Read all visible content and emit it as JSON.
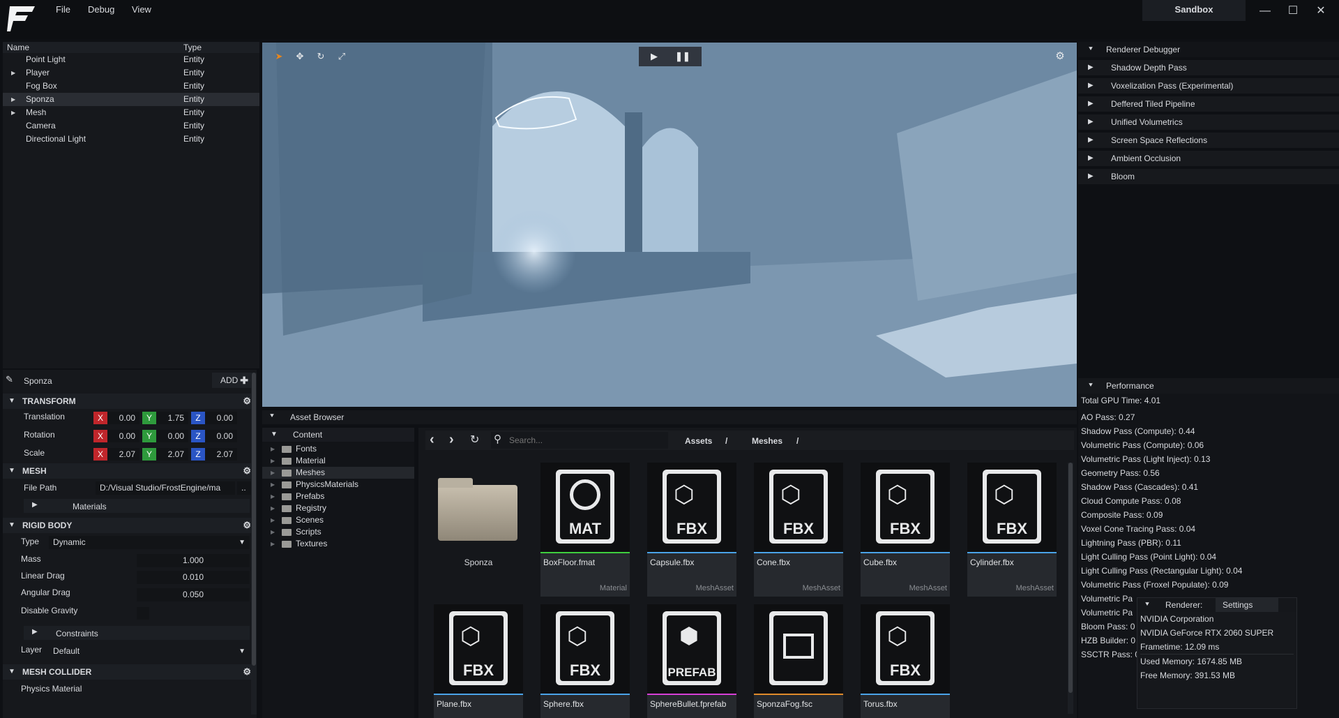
{
  "menu": {
    "file": "File",
    "debug": "Debug",
    "view": "View"
  },
  "window": {
    "title": "Sandbox",
    "minimize": "—",
    "maximize": "☐",
    "close": "✕"
  },
  "hierarchy": {
    "col_name": "Name",
    "col_type": "Type",
    "rows": [
      {
        "name": "Point Light",
        "type": "Entity"
      },
      {
        "name": "Player",
        "type": "Entity"
      },
      {
        "name": "Fog Box",
        "type": "Entity"
      },
      {
        "name": "Sponza",
        "type": "Entity"
      },
      {
        "name": "Mesh",
        "type": "Entity"
      },
      {
        "name": "Camera",
        "type": "Entity"
      },
      {
        "name": "Directional Light",
        "type": "Entity"
      }
    ]
  },
  "inspector": {
    "entity_name": "Sponza",
    "add_label": "ADD",
    "transform": {
      "title": "TRANSFORM",
      "translation": {
        "label": "Translation",
        "x": "0.00",
        "y": "1.75",
        "z": "0.00"
      },
      "rotation": {
        "label": "Rotation",
        "x": "0.00",
        "y": "0.00",
        "z": "0.00"
      },
      "scale": {
        "label": "Scale",
        "x": "2.07",
        "y": "2.07",
        "z": "2.07"
      }
    },
    "axis": {
      "x": "X",
      "y": "Y",
      "z": "Z"
    },
    "mesh": {
      "title": "MESH",
      "file_path_label": "File Path",
      "file_path": "D:/Visual Studio/FrostEngine/ma",
      "browse": "..",
      "materials": "Materials"
    },
    "rigid_body": {
      "title": "RIGID BODY",
      "type_label": "Type",
      "type_value": "Dynamic",
      "mass_label": "Mass",
      "mass": "1.000",
      "linear_drag_label": "Linear Drag",
      "linear_drag": "0.010",
      "angular_drag_label": "Angular Drag",
      "angular_drag": "0.050",
      "disable_gravity_label": "Disable Gravity",
      "constraints": "Constraints",
      "layer_label": "Layer",
      "layer_value": "Default"
    },
    "mesh_collider": {
      "title": "MESH COLLIDER",
      "physics_material_label": "Physics Material"
    }
  },
  "renderer_debugger": {
    "title": "Renderer Debugger",
    "items": [
      "Shadow Depth Pass",
      "Voxelization Pass (Experimental)",
      "Deffered Tiled Pipeline",
      "Unified Volumetrics",
      "Screen Space Reflections",
      "Ambient Occlusion",
      "Bloom"
    ]
  },
  "performance": {
    "title": "Performance",
    "total": "Total GPU Time: 4.01",
    "lines": [
      "AO Pass: 0.27",
      "Shadow Pass (Compute): 0.44",
      "Volumetric Pass (Compute): 0.06",
      "Volumetric Pass (Light Inject): 0.13",
      "Geometry Pass: 0.56",
      "Shadow Pass (Cascades): 0.41",
      "Cloud Compute Pass: 0.08",
      "Composite Pass: 0.09",
      "Voxel Cone Tracing Pass: 0.04",
      "Lightning Pass (PBR): 0.11",
      "Light Culling Pass (Point Light): 0.04",
      "Light Culling Pass (Rectangular Light): 0.04",
      "Volumetric Pass (Froxel Populate): 0.09",
      "Volumetric Pa",
      "Volumetric Pa",
      "Bloom Pass: 0",
      "HZB Builder: 0",
      "SSCTR Pass: 0"
    ]
  },
  "renderer_panel": {
    "tab_renderer": "Renderer:",
    "tab_settings": "Settings",
    "vendor": "NVIDIA Corporation",
    "gpu": "NVIDIA GeForce RTX 2060 SUPER",
    "frametime": "Frametime: 12.09 ms",
    "used_memory": "Used Memory: 1674.85 MB",
    "free_memory": "Free Memory: 391.53 MB"
  },
  "asset_browser": {
    "title": "Asset Browser",
    "root": "Content",
    "folders": [
      "Fonts",
      "Material",
      "Meshes",
      "PhysicsMaterials",
      "Prefabs",
      "Registry",
      "Scenes",
      "Scripts",
      "Textures"
    ],
    "search_placeholder": "Search...",
    "breadcrumb": [
      "Assets",
      "/",
      "Meshes",
      "/"
    ],
    "items": [
      {
        "name": "Sponza",
        "type": "",
        "ext": "",
        "kind": "folder",
        "color": ""
      },
      {
        "name": "BoxFloor.fmat",
        "type": "Material",
        "ext": "MAT",
        "kind": "mat",
        "color": "#3fcf3f"
      },
      {
        "name": "Capsule.fbx",
        "type": "MeshAsset",
        "ext": "FBX",
        "kind": "fbx",
        "color": "#4aa3e8"
      },
      {
        "name": "Cone.fbx",
        "type": "MeshAsset",
        "ext": "FBX",
        "kind": "fbx",
        "color": "#4aa3e8"
      },
      {
        "name": "Cube.fbx",
        "type": "MeshAsset",
        "ext": "FBX",
        "kind": "fbx",
        "color": "#4aa3e8"
      },
      {
        "name": "Cylinder.fbx",
        "type": "MeshAsset",
        "ext": "FBX",
        "kind": "fbx",
        "color": "#4aa3e8"
      },
      {
        "name": "Plane.fbx",
        "type": "",
        "ext": "FBX",
        "kind": "fbx",
        "color": "#4aa3e8"
      },
      {
        "name": "Sphere.fbx",
        "type": "",
        "ext": "FBX",
        "kind": "fbx",
        "color": "#4aa3e8"
      },
      {
        "name": "SphereBullet.fprefab",
        "type": "",
        "ext": "PREFAB",
        "kind": "prefab",
        "color": "#d63fd6"
      },
      {
        "name": "SponzaFog.fsc",
        "type": "",
        "ext": "",
        "kind": "image",
        "color": "#e08a2a"
      },
      {
        "name": "Torus.fbx",
        "type": "",
        "ext": "FBX",
        "kind": "fbx",
        "color": "#4aa3e8"
      }
    ]
  }
}
